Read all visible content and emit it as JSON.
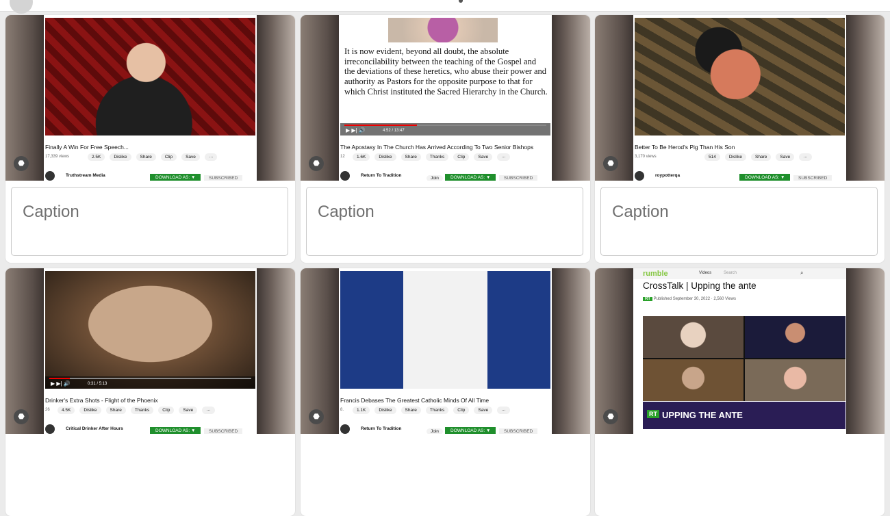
{
  "cards": [
    {
      "video_title": "Finally A Win For Free Speech...",
      "meta": "17,339 views",
      "actions": [
        "2.5K",
        "Dislike",
        "Share",
        "Clip",
        "Save",
        "···"
      ],
      "channel": "Truthstream Media",
      "join": "",
      "download": "DOWNLOAD AS: ▼",
      "subscribed": "SUBSCRIBED",
      "time": "",
      "caption_placeholder": "Caption"
    },
    {
      "video_title": "The Apostasy In The Church Has Arrived According To Two Senior Bishops",
      "meta": "12",
      "quote": "It is now evident, beyond all doubt, the absolute irreconcilability between the teaching of the Gospel and the deviations of these heretics, who abuse their power and authority as Pastors for the opposite purpose to that for which Christ instituted the Sacred Hierarchy in the Church.",
      "actions": [
        "1.6K",
        "Dislike",
        "Share",
        "Thanks",
        "Clip",
        "Save",
        "···"
      ],
      "channel": "Return To Tradition",
      "join": "Join",
      "download": "DOWNLOAD AS: ▼",
      "subscribed": "SUBSCRIBED",
      "time": "4:52 / 13:47",
      "caption_placeholder": "Caption"
    },
    {
      "video_title": "Better To Be Herod's Pig Than His Son",
      "meta": "3,170 views",
      "actions": [
        "514",
        "Dislike",
        "Share",
        "Save",
        "···"
      ],
      "channel": "roypotterqa",
      "join": "",
      "download": "DOWNLOAD AS: ▼",
      "subscribed": "SUBSCRIBED",
      "time": "",
      "caption_placeholder": "Caption"
    },
    {
      "video_title": "Drinker's Extra Shots - Flight of the Phoenix",
      "meta": "26",
      "actions": [
        "4.5K",
        "Dislike",
        "Share",
        "Thanks",
        "Clip",
        "Save",
        "···"
      ],
      "channel": "Critical Drinker After Hours",
      "join": "",
      "download": "DOWNLOAD AS: ▼",
      "subscribed": "SUBSCRIBED",
      "time": "0:31 / 5:13"
    },
    {
      "video_title": "Francis Debases The Greatest Catholic Minds Of All Time",
      "meta": "8.",
      "actions": [
        "1.1K",
        "Dislike",
        "Share",
        "Thanks",
        "Clip",
        "Save",
        "···"
      ],
      "channel": "Return To Tradition",
      "join": "Join",
      "download": "DOWNLOAD AS: ▼",
      "subscribed": "SUBSCRIBED",
      "time": ""
    },
    {
      "rumble_logo": "rumble",
      "rumble_tab": "Videos",
      "rumble_search": "Search",
      "video_title": "CrossTalk | Upping the ante",
      "rt_channel": "RT",
      "meta": "Published September 30, 2022 · 2,560 Views",
      "banner_logo": "RT",
      "banner": "UPPING THE ANTE"
    }
  ],
  "icons": {
    "tag": "tag-icon",
    "like": "thumbs-up-icon"
  }
}
